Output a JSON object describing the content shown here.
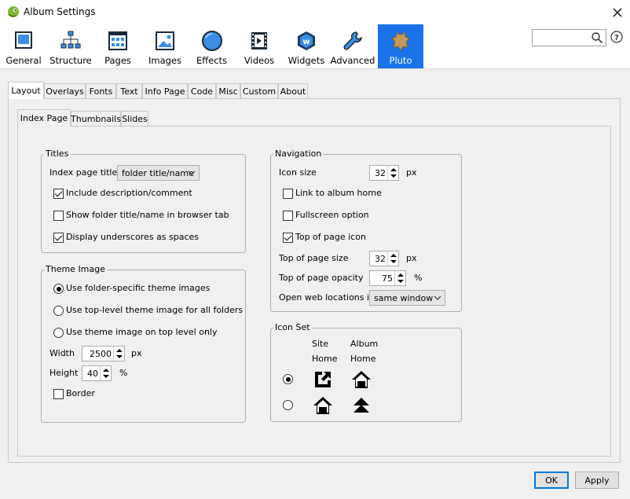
{
  "window": {
    "title": "Album Settings"
  },
  "toolbar": {
    "items": [
      {
        "label": "General",
        "icon": "monitor-icon"
      },
      {
        "label": "Structure",
        "icon": "hierarchy-icon"
      },
      {
        "label": "Pages",
        "icon": "pages-grid-icon"
      },
      {
        "label": "Images",
        "icon": "picture-icon"
      },
      {
        "label": "Effects",
        "icon": "circle-effect-icon"
      },
      {
        "label": "Videos",
        "icon": "film-icon"
      },
      {
        "label": "Widgets",
        "icon": "widget-hexagon-icon"
      },
      {
        "label": "Advanced",
        "icon": "wrench-icon"
      },
      {
        "label": "Pluto",
        "icon": "pluto-skin-icon"
      }
    ],
    "active": "Pluto",
    "accent_color": "#1a73e8",
    "search": {
      "value": "",
      "placeholder": ""
    }
  },
  "tabs": {
    "main": [
      "Layout",
      "Overlays",
      "Fonts",
      "Text",
      "Info Page",
      "Code",
      "Misc",
      "Custom",
      "About"
    ],
    "main_selected": "Layout",
    "sub": [
      "Index Page",
      "Thumbnails",
      "Slides"
    ],
    "sub_selected": "Index Page"
  },
  "titles": {
    "legend": "Titles",
    "index_page_title_label": "Index page title",
    "index_page_title_value": "folder title/name",
    "include_description": {
      "label": "Include description/comment",
      "checked": true
    },
    "show_folder_title": {
      "label": "Show folder title/name in browser tab",
      "checked": false
    },
    "display_underscores": {
      "label": "Display underscores as spaces",
      "checked": true
    }
  },
  "theme_image": {
    "legend": "Theme Image",
    "options": [
      {
        "label": "Use folder-specific theme images",
        "selected": true
      },
      {
        "label": "Use top-level theme image for all folders",
        "selected": false
      },
      {
        "label": "Use theme image on top level only",
        "selected": false
      }
    ],
    "width_label": "Width",
    "width_value": "2500",
    "width_unit": "px",
    "height_label": "Height",
    "height_value": "40",
    "height_unit": "%",
    "border": {
      "label": "Border",
      "checked": false
    }
  },
  "navigation": {
    "legend": "Navigation",
    "icon_size_label": "Icon size",
    "icon_size_value": "32",
    "icon_size_unit": "px",
    "link_album_home": {
      "label": "Link to album home",
      "checked": false
    },
    "fullscreen_option": {
      "label": "Fullscreen option",
      "checked": false
    },
    "top_of_page_icon": {
      "label": "Top of page icon",
      "checked": true
    },
    "top_size_label": "Top of page size",
    "top_size_value": "32",
    "top_size_unit": "px",
    "top_opacity_label": "Top of page opacity",
    "top_opacity_value": "75",
    "top_opacity_unit": "%",
    "open_web_label": "Open web locations in",
    "open_web_value": "same window"
  },
  "icon_set": {
    "legend": "Icon Set",
    "col1": [
      "Site",
      "Home"
    ],
    "col2": [
      "Album",
      "Home"
    ],
    "selected_row": 0
  },
  "footer": {
    "ok": "OK",
    "apply": "Apply"
  }
}
